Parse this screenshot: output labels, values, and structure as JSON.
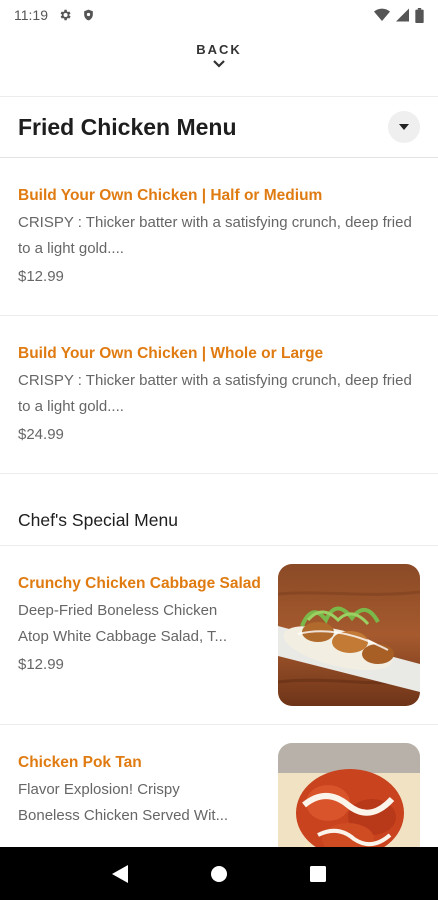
{
  "status_bar": {
    "time": "11:19"
  },
  "back": {
    "label": "BACK"
  },
  "header": {
    "title": "Fried Chicken Menu"
  },
  "items": [
    {
      "name": "Build Your Own Chicken | Half or Medium",
      "description": "CRISPY : Thicker batter with a satisfying crunch, deep fried to a light gold....",
      "price": "$12.99"
    },
    {
      "name": "Build Your Own Chicken | Whole  or Large",
      "description": "CRISPY : Thicker batter with a satisfying crunch, deep fried to a light gold....",
      "price": "$24.99"
    }
  ],
  "section": {
    "title": "Chef's Special Menu"
  },
  "special_items": [
    {
      "name": "Crunchy Chicken Cabbage Salad",
      "description_line1": "Deep-Fried Boneless Chicken",
      "description_line2": "Atop White Cabbage Salad, T...",
      "price": "$12.99"
    },
    {
      "name": "Chicken Pok Tan",
      "description_line1": "Flavor Explosion! Crispy",
      "description_line2": "Boneless Chicken Served Wit..."
    }
  ],
  "colors": {
    "accent": "#e07b12",
    "text_muted": "#666666",
    "nav_bar": "#000000"
  },
  "icons": [
    "settings-icon",
    "shield-icon",
    "wifi-icon",
    "signal-icon",
    "battery-icon",
    "chevron-down-icon",
    "dropdown-arrow-icon",
    "nav-back-icon",
    "nav-home-icon",
    "nav-recents-icon"
  ]
}
